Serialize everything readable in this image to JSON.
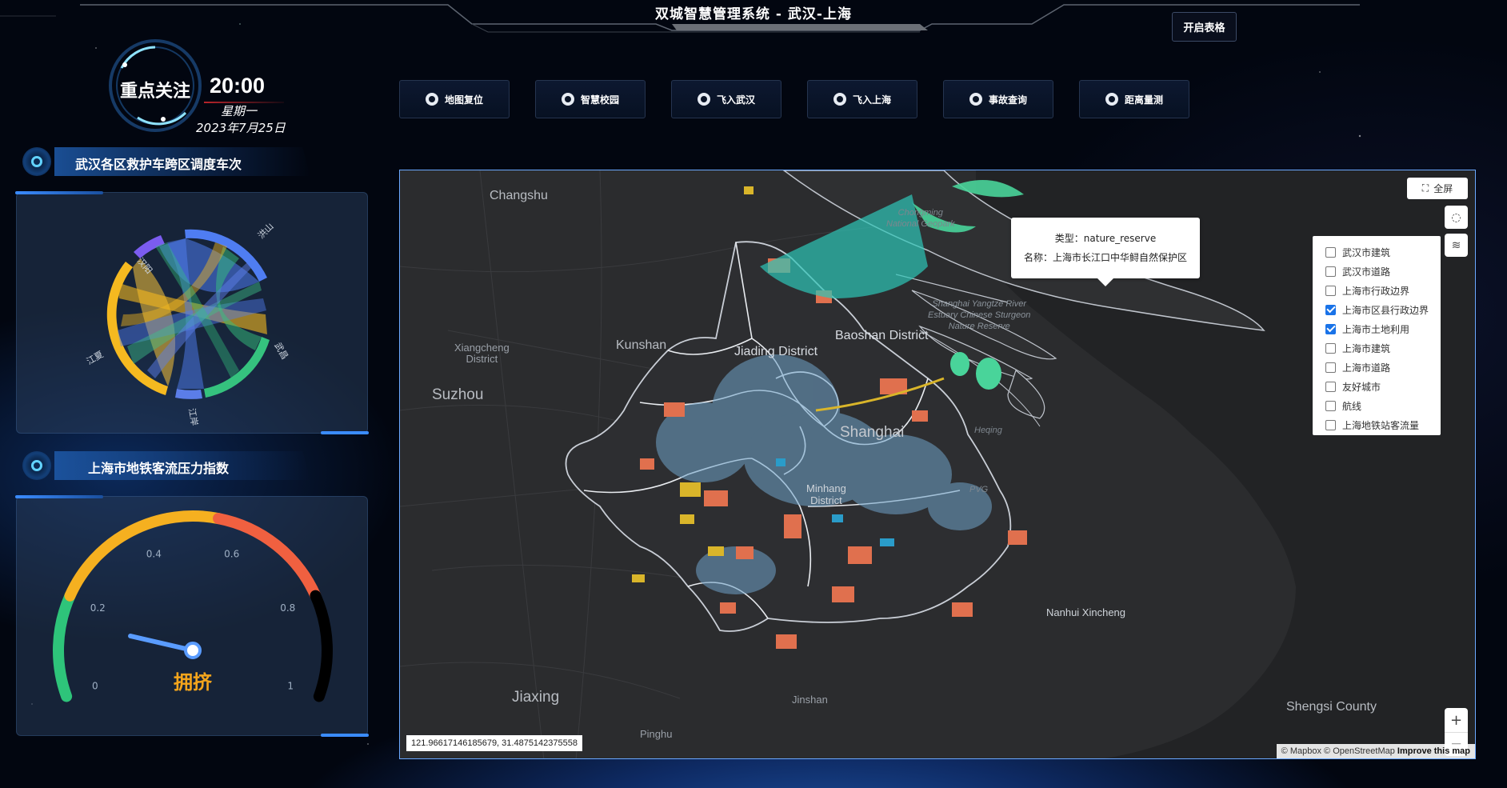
{
  "header": {
    "title": "双城智慧管理系统 - 武汉-上海",
    "open_table_label": "开启表格"
  },
  "clock": {
    "focus_label": "重点关注",
    "time": "20:00",
    "weekday": "星期一",
    "date": "2023年7月25日"
  },
  "panels": {
    "chord": {
      "title": "武汉各区救护车跨区调度车次",
      "groups": [
        "汉阳",
        "洪山",
        "武昌",
        "江岸",
        "江夏"
      ],
      "colors": [
        "#7b5cf0",
        "#4f7df2",
        "#35c27e",
        "#5b7de8",
        "#f5b920"
      ]
    },
    "gauge": {
      "title": "上海市地铁客流压力指数",
      "ticks": [
        "0",
        "0.2",
        "0.4",
        "0.6",
        "0.8",
        "1"
      ],
      "value": 0.15,
      "status": "拥挤",
      "colors": [
        "#2ec47a",
        "#f5b020",
        "#f06040",
        "#000000"
      ]
    }
  },
  "toolbar": [
    {
      "label": "地图复位",
      "icon": "reset-icon"
    },
    {
      "label": "智慧校园",
      "icon": "campus-icon"
    },
    {
      "label": "飞入武汉",
      "icon": "plane-icon"
    },
    {
      "label": "飞入上海",
      "icon": "plane-icon"
    },
    {
      "label": "事故查询",
      "icon": "accident-icon"
    },
    {
      "label": "距离量测",
      "icon": "ruler-icon"
    }
  ],
  "map": {
    "fullscreen_label": "全屏",
    "places": {
      "changshu": "Changshu",
      "chongming": "Chongming\nNational Geopark",
      "xiangcheng": "Xiangcheng\nDistrict",
      "kunshan": "Kunshan",
      "suzhou": "Suzhou",
      "jiading": "Jiading District",
      "baoshan": "Baoshan District",
      "shanghai": "Shanghai",
      "minhang": "Minhang\nDistrict",
      "pvg": "PVG",
      "nanhui": "Nanhui Xincheng",
      "jiaxing": "Jiaxing",
      "pinghu": "Pinghu",
      "jinshan": "Jinshan",
      "shengsi": "Shengsi County",
      "sturgeon": "Shanghai Yangtze River\nEstuary Chinese Sturgeon\nNature Reserve",
      "heqing": "Heqing"
    },
    "popup": {
      "type_line": "类型：nature_reserve",
      "name_line": "名称：上海市长江口中华鲟自然保护区"
    },
    "layers": [
      {
        "label": "武汉市建筑",
        "checked": false
      },
      {
        "label": "武汉市道路",
        "checked": false
      },
      {
        "label": "上海市行政边界",
        "checked": false
      },
      {
        "label": "上海市区县行政边界",
        "checked": true
      },
      {
        "label": "上海市土地利用",
        "checked": true
      },
      {
        "label": "上海市建筑",
        "checked": false
      },
      {
        "label": "上海市道路",
        "checked": false
      },
      {
        "label": "友好城市",
        "checked": false
      },
      {
        "label": "航线",
        "checked": false
      },
      {
        "label": "上海地铁站客流量",
        "checked": false
      }
    ],
    "coords": "121.96617146185679, 31.4875142375558",
    "attribution": {
      "mapbox": "© Mapbox",
      "osm": "© OpenStreetMap",
      "improve": "Improve this map"
    },
    "zoom_in": "+",
    "zoom_out": "−"
  }
}
